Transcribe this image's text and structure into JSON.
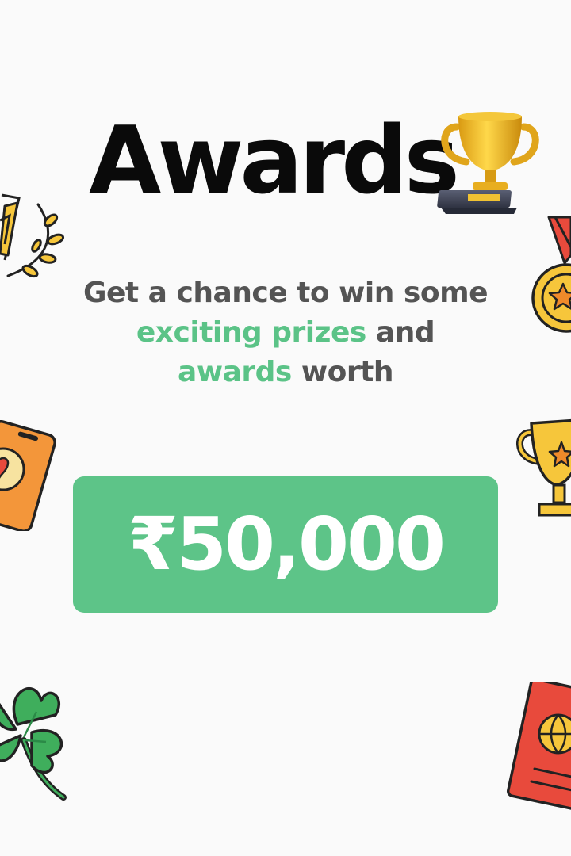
{
  "heading": {
    "title": "Awards"
  },
  "tagline": {
    "part1": "Get a chance to win some",
    "highlight1": "exciting prizes",
    "part2": "and",
    "highlight2": "awards",
    "part3": "worth"
  },
  "prize": {
    "amount": "₹50,000"
  },
  "colors": {
    "background": "#fafafa",
    "title": "#0a0a0a",
    "text": "#545454",
    "accent_green": "#5dc488",
    "prize_text": "#ffffff"
  },
  "decorations": [
    "laurel-number-one-icon",
    "gold-trophy-3d-icon",
    "star-medal-icon",
    "phone-heart-icon",
    "star-trophy-cup-icon",
    "four-leaf-clover-icon",
    "passport-icon"
  ]
}
